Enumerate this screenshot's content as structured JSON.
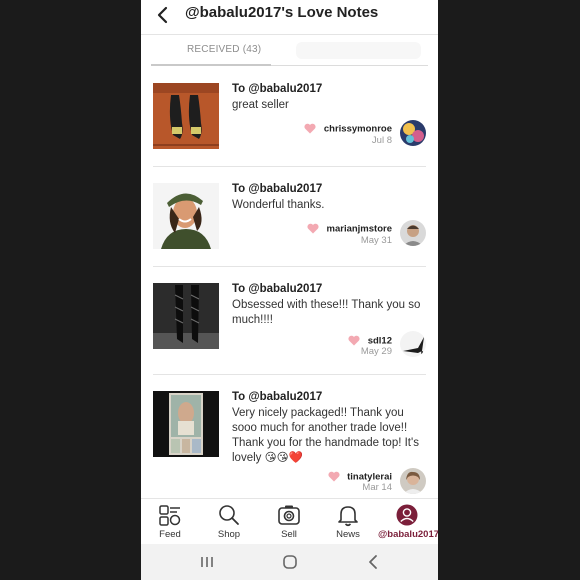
{
  "header": {
    "title": "@babalu2017's Love Notes"
  },
  "tabs": {
    "received_label": "RECEIVED",
    "received_count": "(43)"
  },
  "notes": [
    {
      "to": "To @babalu2017",
      "message": "great seller",
      "username": "chrissymonroe",
      "date": "Jul 8"
    },
    {
      "to": "To @babalu2017",
      "message": "Wonderful thanks.",
      "username": "marianjmstore",
      "date": "May 31"
    },
    {
      "to": "To @babalu2017",
      "message": "Obsessed with these!!! Thank you so much!!!!",
      "username": "sdl12",
      "date": "May 29"
    },
    {
      "to": "To @babalu2017",
      "message": "Very nicely packaged!! Thank you sooo much for another trade love!! Thank you for the handmade top! It's lovely 😘😘❤️",
      "username": "tinatylerai",
      "date": "Mar 14"
    }
  ],
  "bottom_nav": [
    {
      "label": "Feed",
      "icon": "feed-icon"
    },
    {
      "label": "Shop",
      "icon": "search-icon"
    },
    {
      "label": "Sell",
      "icon": "camera-icon"
    },
    {
      "label": "News",
      "icon": "bell-icon"
    },
    {
      "label": "@babalu2017",
      "icon": "profile-avatar-icon"
    }
  ],
  "colors": {
    "accent": "#7b1f3a",
    "heart": "#f3a9b2",
    "divider": "#e4e4e4",
    "muted": "#9a9a9a"
  }
}
